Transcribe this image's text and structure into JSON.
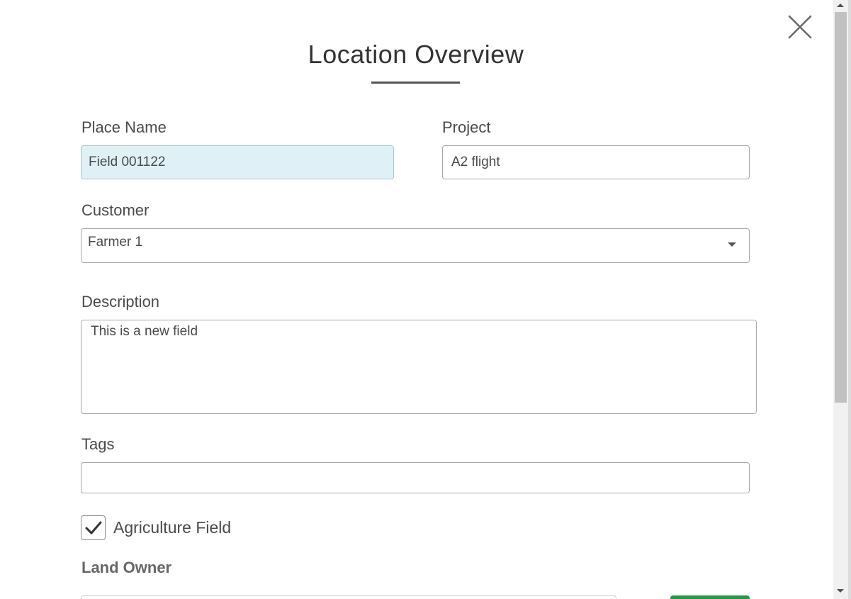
{
  "modal": {
    "title": "Location Overview"
  },
  "form": {
    "place_name": {
      "label": "Place Name",
      "value": "Field 001122"
    },
    "project": {
      "label": "Project",
      "value": "A2 flight"
    },
    "customer": {
      "label": "Customer",
      "selected": "Farmer 1"
    },
    "description": {
      "label": "Description",
      "value": "This is a new field"
    },
    "tags": {
      "label": "Tags",
      "value": ""
    },
    "agriculture_field": {
      "label": "Agriculture Field",
      "checked": true
    },
    "land_owner": {
      "label": "Land Owner"
    }
  },
  "icons": {
    "close": "close-icon",
    "dropdown": "chevron-down-icon",
    "check": "check-icon"
  },
  "colors": {
    "highlight_input_bg": "#dff1f7",
    "add_button_green": "#1a9f3f",
    "text": "#4a4a4a"
  }
}
